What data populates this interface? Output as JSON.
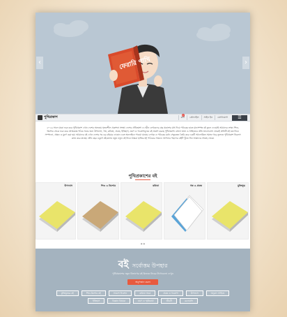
{
  "hero": {
    "book_title": "ফেরারি পাখি",
    "prev_label": "‹",
    "next_label": "›"
  },
  "navbar": {
    "logo_text": "পুথিপ্রকাশ",
    "links": [
      "কার্ট",
      "প্রোফাইল",
      "সাইন ইন",
      "যোগাযোগ"
    ],
    "cart_count": "0",
    "menu_icon": "☰"
  },
  "intro": {
    "text": "২০১৬ সালে যাত্রা শুরু করে পুথিপ্রকাশ এখন দেশের অন্যতম সৃজনশীল প্রকাশনা সংস্থা। দেশের প্রথিতযশা ও নবীন লেখকদের গ্রন্থ প্রকাশের মধ্য দিয়ে পাঠকের হাতে মানসম্পন্ন বই তুলে দেওয়াই আমাদের লক্ষ্য। শিশু-কিশোর থেকে শুরু করে প্রাপ্তবয়স্ক পাঠক সবার জন্য উপন্যাস, গল্প, কবিতা, প্রবন্ধ, ইতিহাস, ভ্রমণ ও গবেষণামূলক বই প্রকাশ করছে পুথিপ্রকাশ। বাংলা ভাষা ও সাহিত্যের প্রতি ভালোবাসা থেকেই প্রতিটি বই যত্ন নিয়ে সম্পাদনা, প্রচ্ছদ ও মুদ্রণ করা হয়। আমাদের বই এখন দেশের সব বড় বইয়ের দোকান এবং অনলাইনে পাওয়া যাচ্ছে। লেখক ও পাঠকের মধ্যে সেতুবন্ধন তৈরি করে একটি আলোকিত সমাজ গড়ে তুলতে পুথিপ্রকাশ নিরলস কাজ করে যাচ্ছে। প্রতি বছর একুশে বইমেলায় নতুন নতুন বই নিয়ে আমরা হাজির হই পাঠকের সামনে। আপনার পছন্দের বইটি খুঁজে নিন আমাদের সংগ্রহ থেকে।"
  },
  "books": {
    "section_title": "পুথিপ্রকাশের বই",
    "categories": [
      "উপন্যাস",
      "শিশু ও কিশোর",
      "কবিতা",
      "গল্প ও প্রবন্ধ",
      "মুক্তিযুদ্ধ"
    ],
    "cover_colors": [
      "#e9e46a",
      "#c9a878",
      "#e9e46a",
      "#5aa4d8",
      "#e9e46a"
    ]
  },
  "gift": {
    "title_big": "বই",
    "title_rest": "সর্বোত্তম উপহার",
    "subtitle": "পুথিপ্রকাশের নতুন বিভাগের বই কিনতে নিচের ট্যাগগুলো দেখুন",
    "cta": "অনুসন্ধান করুন",
    "tags": [
      "মুক্তিযুদ্ধের বই",
      "শিশু-কিশোর বই",
      "সায়েন্স ফিকশন",
      "কবিতা সমগ্র",
      "প্রবন্ধ ও গবেষণা",
      "উপন্যাস",
      "অনুবাদ সাহিত্য",
      "ইতিহাস",
      "বিজ্ঞান বিষয়ক",
      "ভ্রমণ ও স্মৃতিকথা",
      "জীবনী",
      "রচনাবলি"
    ]
  }
}
